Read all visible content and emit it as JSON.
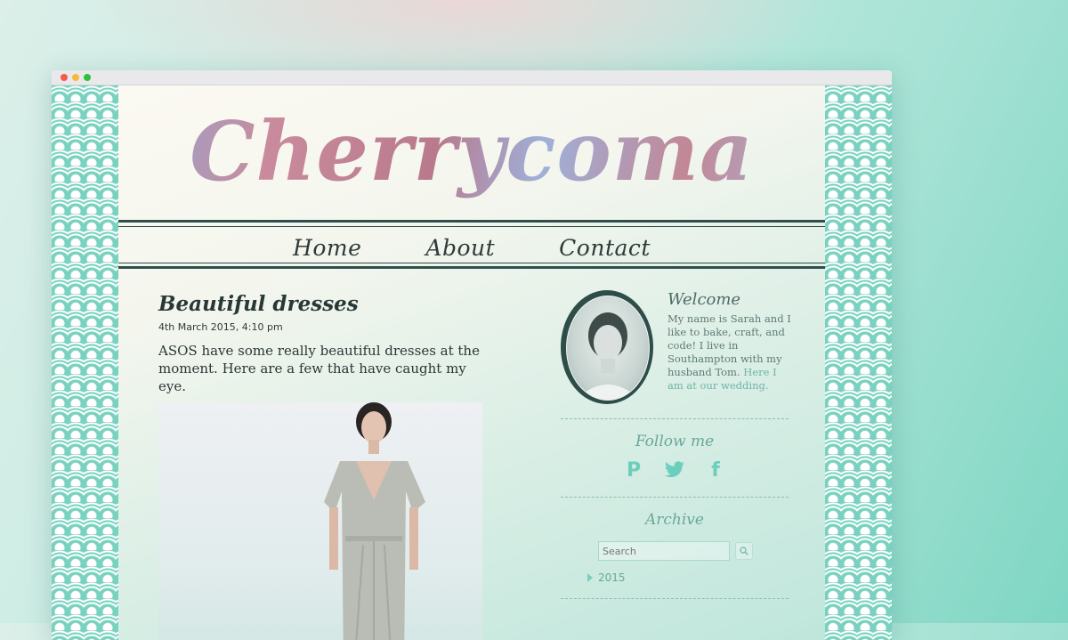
{
  "site": {
    "logo": "Cherrycoma"
  },
  "nav": {
    "items": [
      "Home",
      "About",
      "Contact"
    ]
  },
  "post": {
    "title": "Beautiful dresses",
    "date": "4th March 2015, 4:10 pm",
    "body": "ASOS have some really beautiful dresses at the moment. Here are a few that have caught my eye."
  },
  "sidebar": {
    "welcome_title": "Welcome",
    "welcome_text_main": "My name is Sarah and I like to bake, craft, and code! I live in Southampton with my husband Tom.",
    "welcome_text_highlight": "Here I am at our wedding.",
    "follow_heading": "Follow me",
    "social_icons": [
      "pinterest-icon",
      "twitter-icon",
      "facebook-icon"
    ],
    "archive_heading": "Archive",
    "search_placeholder": "Search",
    "archive_years": [
      "2015"
    ]
  },
  "colors": {
    "pattern": "#79d1bf",
    "accent": "#6aa89b",
    "nav_text": "#2e3b3a"
  }
}
